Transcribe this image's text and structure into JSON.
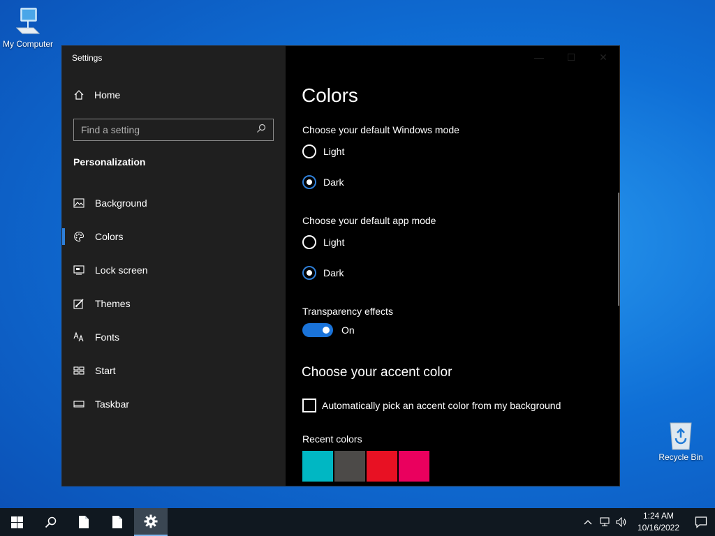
{
  "desktop": {
    "icons": [
      {
        "label": "My Computer",
        "icon": "computer-icon"
      },
      {
        "label": "Recycle Bin",
        "icon": "recycle-bin-icon"
      }
    ]
  },
  "window": {
    "title": "Settings",
    "controls": [
      "minimize-icon",
      "maximize-icon",
      "close-icon"
    ]
  },
  "sidebar": {
    "home_label": "Home",
    "search_placeholder": "Find a setting",
    "section_heading": "Personalization",
    "items": [
      {
        "label": "Background",
        "icon": "picture-icon"
      },
      {
        "label": "Colors",
        "icon": "palette-icon",
        "active": true
      },
      {
        "label": "Lock screen",
        "icon": "lock-screen-icon"
      },
      {
        "label": "Themes",
        "icon": "themes-brush-icon"
      },
      {
        "label": "Fonts",
        "icon": "fonts-icon"
      },
      {
        "label": "Start",
        "icon": "start-grid-icon"
      },
      {
        "label": "Taskbar",
        "icon": "taskbar-icon"
      }
    ]
  },
  "content": {
    "title": "Colors",
    "windows_mode": {
      "label": "Choose your default Windows mode",
      "options": [
        "Light",
        "Dark"
      ],
      "selected": "Dark"
    },
    "app_mode": {
      "label": "Choose your default app mode",
      "options": [
        "Light",
        "Dark"
      ],
      "selected": "Dark"
    },
    "transparency": {
      "label": "Transparency effects",
      "state": "On"
    },
    "accent_heading": "Choose your accent color",
    "auto_accent_label": "Automatically pick an accent color from my background",
    "auto_accent_checked": false,
    "recent_colors_label": "Recent colors",
    "recent_colors": [
      "#00b7c3",
      "#4c4a48",
      "#e81123",
      "#ea005e"
    ]
  },
  "taskbar": {
    "time": "1:24 AM",
    "date": "10/16/2022",
    "accent": "#1a73d9"
  }
}
